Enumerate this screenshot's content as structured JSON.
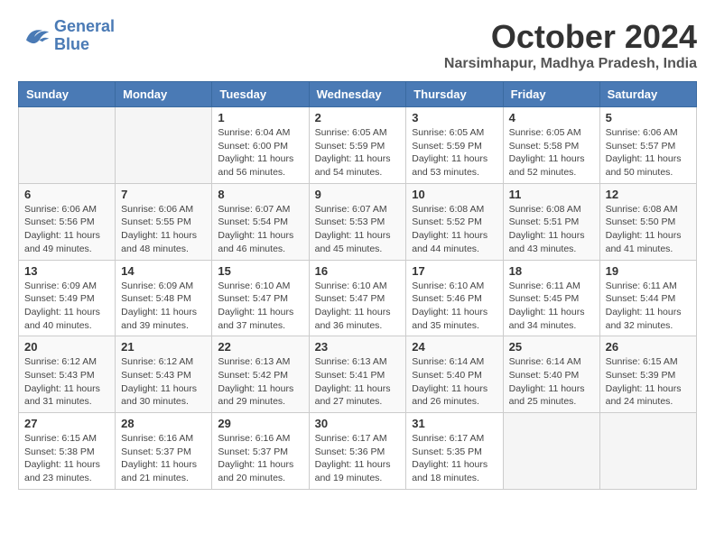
{
  "logo": {
    "line1": "General",
    "line2": "Blue"
  },
  "title": "October 2024",
  "subtitle": "Narsimhapur, Madhya Pradesh, India",
  "days_of_week": [
    "Sunday",
    "Monday",
    "Tuesday",
    "Wednesday",
    "Thursday",
    "Friday",
    "Saturday"
  ],
  "weeks": [
    [
      {
        "day": "",
        "sunrise": "",
        "sunset": "",
        "daylight": ""
      },
      {
        "day": "",
        "sunrise": "",
        "sunset": "",
        "daylight": ""
      },
      {
        "day": "1",
        "sunrise": "Sunrise: 6:04 AM",
        "sunset": "Sunset: 6:00 PM",
        "daylight": "Daylight: 11 hours and 56 minutes."
      },
      {
        "day": "2",
        "sunrise": "Sunrise: 6:05 AM",
        "sunset": "Sunset: 5:59 PM",
        "daylight": "Daylight: 11 hours and 54 minutes."
      },
      {
        "day": "3",
        "sunrise": "Sunrise: 6:05 AM",
        "sunset": "Sunset: 5:59 PM",
        "daylight": "Daylight: 11 hours and 53 minutes."
      },
      {
        "day": "4",
        "sunrise": "Sunrise: 6:05 AM",
        "sunset": "Sunset: 5:58 PM",
        "daylight": "Daylight: 11 hours and 52 minutes."
      },
      {
        "day": "5",
        "sunrise": "Sunrise: 6:06 AM",
        "sunset": "Sunset: 5:57 PM",
        "daylight": "Daylight: 11 hours and 50 minutes."
      }
    ],
    [
      {
        "day": "6",
        "sunrise": "Sunrise: 6:06 AM",
        "sunset": "Sunset: 5:56 PM",
        "daylight": "Daylight: 11 hours and 49 minutes."
      },
      {
        "day": "7",
        "sunrise": "Sunrise: 6:06 AM",
        "sunset": "Sunset: 5:55 PM",
        "daylight": "Daylight: 11 hours and 48 minutes."
      },
      {
        "day": "8",
        "sunrise": "Sunrise: 6:07 AM",
        "sunset": "Sunset: 5:54 PM",
        "daylight": "Daylight: 11 hours and 46 minutes."
      },
      {
        "day": "9",
        "sunrise": "Sunrise: 6:07 AM",
        "sunset": "Sunset: 5:53 PM",
        "daylight": "Daylight: 11 hours and 45 minutes."
      },
      {
        "day": "10",
        "sunrise": "Sunrise: 6:08 AM",
        "sunset": "Sunset: 5:52 PM",
        "daylight": "Daylight: 11 hours and 44 minutes."
      },
      {
        "day": "11",
        "sunrise": "Sunrise: 6:08 AM",
        "sunset": "Sunset: 5:51 PM",
        "daylight": "Daylight: 11 hours and 43 minutes."
      },
      {
        "day": "12",
        "sunrise": "Sunrise: 6:08 AM",
        "sunset": "Sunset: 5:50 PM",
        "daylight": "Daylight: 11 hours and 41 minutes."
      }
    ],
    [
      {
        "day": "13",
        "sunrise": "Sunrise: 6:09 AM",
        "sunset": "Sunset: 5:49 PM",
        "daylight": "Daylight: 11 hours and 40 minutes."
      },
      {
        "day": "14",
        "sunrise": "Sunrise: 6:09 AM",
        "sunset": "Sunset: 5:48 PM",
        "daylight": "Daylight: 11 hours and 39 minutes."
      },
      {
        "day": "15",
        "sunrise": "Sunrise: 6:10 AM",
        "sunset": "Sunset: 5:47 PM",
        "daylight": "Daylight: 11 hours and 37 minutes."
      },
      {
        "day": "16",
        "sunrise": "Sunrise: 6:10 AM",
        "sunset": "Sunset: 5:47 PM",
        "daylight": "Daylight: 11 hours and 36 minutes."
      },
      {
        "day": "17",
        "sunrise": "Sunrise: 6:10 AM",
        "sunset": "Sunset: 5:46 PM",
        "daylight": "Daylight: 11 hours and 35 minutes."
      },
      {
        "day": "18",
        "sunrise": "Sunrise: 6:11 AM",
        "sunset": "Sunset: 5:45 PM",
        "daylight": "Daylight: 11 hours and 34 minutes."
      },
      {
        "day": "19",
        "sunrise": "Sunrise: 6:11 AM",
        "sunset": "Sunset: 5:44 PM",
        "daylight": "Daylight: 11 hours and 32 minutes."
      }
    ],
    [
      {
        "day": "20",
        "sunrise": "Sunrise: 6:12 AM",
        "sunset": "Sunset: 5:43 PM",
        "daylight": "Daylight: 11 hours and 31 minutes."
      },
      {
        "day": "21",
        "sunrise": "Sunrise: 6:12 AM",
        "sunset": "Sunset: 5:43 PM",
        "daylight": "Daylight: 11 hours and 30 minutes."
      },
      {
        "day": "22",
        "sunrise": "Sunrise: 6:13 AM",
        "sunset": "Sunset: 5:42 PM",
        "daylight": "Daylight: 11 hours and 29 minutes."
      },
      {
        "day": "23",
        "sunrise": "Sunrise: 6:13 AM",
        "sunset": "Sunset: 5:41 PM",
        "daylight": "Daylight: 11 hours and 27 minutes."
      },
      {
        "day": "24",
        "sunrise": "Sunrise: 6:14 AM",
        "sunset": "Sunset: 5:40 PM",
        "daylight": "Daylight: 11 hours and 26 minutes."
      },
      {
        "day": "25",
        "sunrise": "Sunrise: 6:14 AM",
        "sunset": "Sunset: 5:40 PM",
        "daylight": "Daylight: 11 hours and 25 minutes."
      },
      {
        "day": "26",
        "sunrise": "Sunrise: 6:15 AM",
        "sunset": "Sunset: 5:39 PM",
        "daylight": "Daylight: 11 hours and 24 minutes."
      }
    ],
    [
      {
        "day": "27",
        "sunrise": "Sunrise: 6:15 AM",
        "sunset": "Sunset: 5:38 PM",
        "daylight": "Daylight: 11 hours and 23 minutes."
      },
      {
        "day": "28",
        "sunrise": "Sunrise: 6:16 AM",
        "sunset": "Sunset: 5:37 PM",
        "daylight": "Daylight: 11 hours and 21 minutes."
      },
      {
        "day": "29",
        "sunrise": "Sunrise: 6:16 AM",
        "sunset": "Sunset: 5:37 PM",
        "daylight": "Daylight: 11 hours and 20 minutes."
      },
      {
        "day": "30",
        "sunrise": "Sunrise: 6:17 AM",
        "sunset": "Sunset: 5:36 PM",
        "daylight": "Daylight: 11 hours and 19 minutes."
      },
      {
        "day": "31",
        "sunrise": "Sunrise: 6:17 AM",
        "sunset": "Sunset: 5:35 PM",
        "daylight": "Daylight: 11 hours and 18 minutes."
      },
      {
        "day": "",
        "sunrise": "",
        "sunset": "",
        "daylight": ""
      },
      {
        "day": "",
        "sunrise": "",
        "sunset": "",
        "daylight": ""
      }
    ]
  ]
}
